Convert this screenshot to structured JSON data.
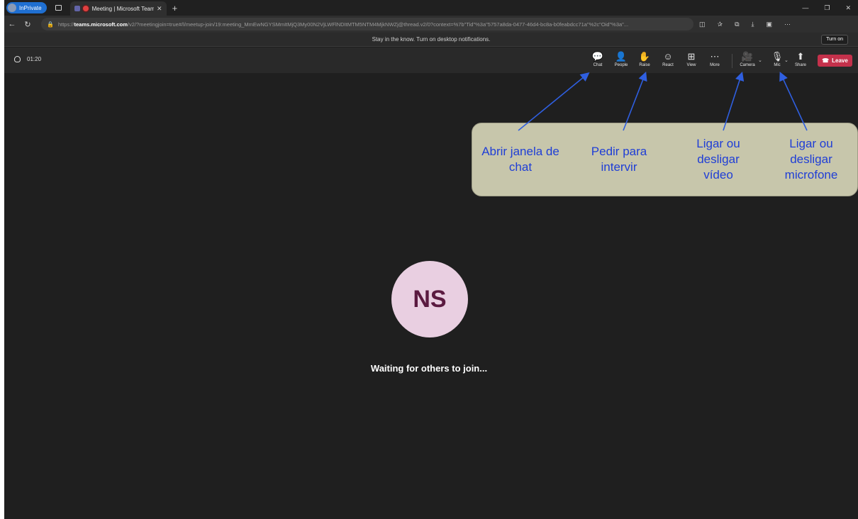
{
  "browser": {
    "profile_label": "InPrivate",
    "tab_title": "Meeting | Microsoft Teams",
    "url_prefix": "https://",
    "url_domain": "teams.microsoft.com",
    "url_rest": "/v2/?meetingjoin=true#/l/meetup-join/19:meeting_MmEwNGYSMmItMjQ3My00N2VjLWFlNDItMTM5NTM4MjkNWZj@thread.v2/0?context=%7b\"Tid\"%3a\"5757a8da-0477-46d4-bc8a-b0feabdcc71a\"%2c\"Oid\"%3a\"..."
  },
  "notification": {
    "text": "Stay in the know. Turn on desktop notifications.",
    "button": "Turn on"
  },
  "toolbar": {
    "timer": "01:20",
    "chat": "Chat",
    "people": "People",
    "raise": "Raise",
    "react": "React",
    "view": "View",
    "more": "More",
    "camera": "Camera",
    "mic": "Mic",
    "share": "Share",
    "leave": "Leave"
  },
  "stage": {
    "initials": "NS",
    "waiting": "Waiting for others to join..."
  },
  "annotations": {
    "chat": "Abrir janela de\nchat",
    "raise": "Pedir para\nintervir",
    "camera": "Ligar ou\ndesligar\nvídeo",
    "mic": "Ligar ou\ndesligar\nmicrofone"
  },
  "colors": {
    "leave": "#c4314b",
    "annotation_text": "#1f3ed6",
    "callout_bg": "#c7c6ab",
    "avatar_bg": "#e9cfe1"
  }
}
